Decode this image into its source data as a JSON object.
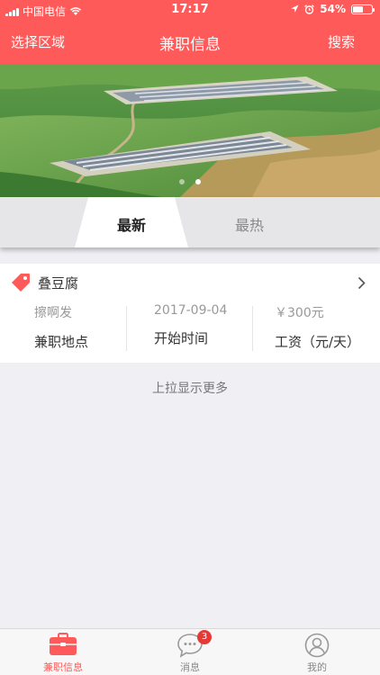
{
  "status": {
    "carrier": "中国电信",
    "time": "17:17",
    "battery": "54%",
    "battery_level": 0.54
  },
  "nav": {
    "left": "选择区域",
    "title": "兼职信息",
    "right": "搜索"
  },
  "banner": {
    "page_count": 2,
    "current_page": 2
  },
  "tabs": [
    {
      "label": "最新",
      "active": true
    },
    {
      "label": "最热",
      "active": false
    }
  ],
  "job": {
    "name": "叠豆腐",
    "location": "擦啊发",
    "start_date": "2017-09-04",
    "wage": "￥300元",
    "location_label": "兼职地点",
    "start_label": "开始时间",
    "wage_label": "工资（元/天）"
  },
  "load_more": "上拉显示更多",
  "tabbar": [
    {
      "label": "兼职信息",
      "icon": "briefcase-icon",
      "active": true
    },
    {
      "label": "消息",
      "icon": "chat-bubble-icon",
      "badge": "3"
    },
    {
      "label": "我的",
      "icon": "person-icon"
    }
  ],
  "colors": {
    "accent": "#ff5a5a",
    "badge": "#e53935"
  }
}
